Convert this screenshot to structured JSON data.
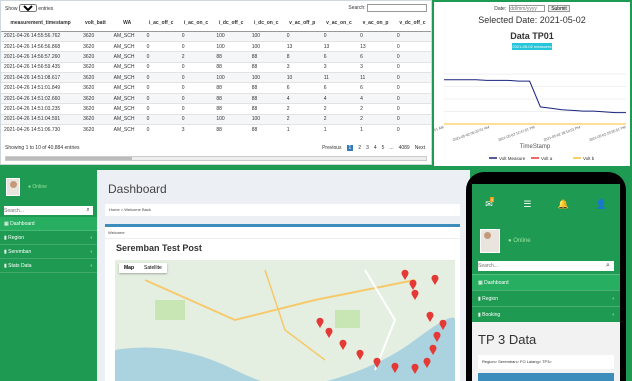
{
  "table": {
    "show_label": "Show",
    "show_value": "10",
    "entries_label": "entries",
    "search_label": "Search:",
    "headers": [
      "measurement_timestamp",
      "volt_batt",
      "WA",
      "i_ac_off_c",
      "i_ac_on_c",
      "i_dc_off_c",
      "i_dc_on_c",
      "v_ac_off_p",
      "v_ac_on_c",
      "v_ac_on_p",
      "v_dc_off_c"
    ],
    "rows": [
      [
        "2021-04-26 14:55:56.762",
        "3620",
        "AM_SCH",
        "0",
        "0",
        "100",
        "100",
        "0",
        "0",
        "0",
        "0"
      ],
      [
        "2021-04-26 14:56:56.868",
        "3620",
        "AM_SCH",
        "0",
        "0",
        "100",
        "100",
        "13",
        "13",
        "13",
        "0"
      ],
      [
        "2021-04-26 14:56:57.260",
        "3620",
        "AM_SCH",
        "0",
        "2",
        "88",
        "88",
        "8",
        "6",
        "6",
        "0"
      ],
      [
        "2021-04-26 14:56:59.435",
        "3620",
        "AM_SCH",
        "0",
        "0",
        "88",
        "88",
        "3",
        "3",
        "3",
        "0"
      ],
      [
        "2021-04-26 14:51:08.617",
        "3620",
        "AM_SCH",
        "0",
        "0",
        "100",
        "100",
        "10",
        "11",
        "11",
        "0"
      ],
      [
        "2021-04-26 14:51:01.849",
        "3620",
        "AM_SCH",
        "0",
        "0",
        "88",
        "88",
        "6",
        "6",
        "6",
        "0"
      ],
      [
        "2021-04-26 14:51:02.660",
        "3620",
        "AM_SCH",
        "0",
        "0",
        "88",
        "88",
        "4",
        "4",
        "4",
        "0"
      ],
      [
        "2021-04-26 14:51:03.235",
        "3620",
        "AM_SCH",
        "0",
        "0",
        "88",
        "88",
        "2",
        "2",
        "2",
        "0"
      ],
      [
        "2021-04-26 14:51:04.591",
        "3620",
        "AM_SCH",
        "0",
        "0",
        "100",
        "100",
        "2",
        "2",
        "2",
        "0"
      ],
      [
        "2021-04-26 14:51:06.730",
        "3620",
        "AM_SCH",
        "0",
        "3",
        "88",
        "88",
        "1",
        "1",
        "1",
        "0"
      ]
    ],
    "info": "Showing 1 to 10 of 40,884 entries",
    "pager": {
      "prev": "Previous",
      "pages": [
        "1",
        "2",
        "3",
        "4",
        "5",
        "...",
        "4089"
      ],
      "next": "Next"
    }
  },
  "chart_panel": {
    "date_label": "Date:",
    "date_placeholder": "dd/mm/yyyy",
    "submit_label": "Submit",
    "selected_date": "Selected Date: 2021-05-02",
    "title": "Data TP01",
    "badge": "2021-05-02 measures",
    "chart_data": {
      "type": "line",
      "xlabel": "TimeStamp",
      "x_ticks": [
        "2021-05-02 00:51:51 AM",
        "2021-05-02 06:22:51 AM",
        "2021-05-02 12:47:51 PM",
        "2021-05-02 18:10:51 PM",
        "2021-05-02 23:55:51 PM"
      ],
      "series": [
        {
          "name": "Volt Measure",
          "color": "#1a237e",
          "values": [
            62,
            62,
            62,
            62,
            61,
            61,
            61,
            60,
            60,
            24,
            22,
            20,
            19,
            18,
            18,
            17,
            16,
            16
          ]
        },
        {
          "name": "Volt a",
          "color": "#e53935",
          "values": [
            0,
            0,
            0,
            0,
            0,
            0,
            0,
            0,
            0,
            0,
            0,
            0,
            0,
            0,
            0,
            0,
            0,
            0
          ]
        },
        {
          "name": "Volt b",
          "color": "#fbc02d",
          "values": [
            0,
            0,
            0,
            0,
            0,
            0,
            0,
            0,
            0,
            0,
            0,
            0,
            0,
            0,
            0,
            0,
            0,
            0
          ]
        }
      ],
      "ylim": [
        0,
        70
      ],
      "legend": "bottom"
    }
  },
  "sidebar": {
    "status": "Online",
    "search_placeholder": "Search...",
    "items": [
      {
        "label": "Dashboard"
      },
      {
        "label": "Region"
      },
      {
        "label": "Seremban"
      },
      {
        "label": "Stats Data"
      }
    ]
  },
  "dashboard": {
    "title": "Dashboard",
    "breadcrumb": "Home > Welcome Back",
    "card_head": "Welcome",
    "card_title": "Seremban Test Post",
    "map_tabs": [
      "Map",
      "Satellite"
    ]
  },
  "phone": {
    "status": "Online",
    "search_placeholder": "Search...",
    "nav_badge": "4",
    "items": [
      {
        "label": "Dashboard"
      },
      {
        "label": "Region"
      },
      {
        "label": "Booking"
      }
    ],
    "title": "TP 3 Data",
    "breadcrumb": "Region> Seremban> FO Lalang> TP3>"
  },
  "colors": {
    "green": "#1f9a52",
    "blue": "#3c8dbc",
    "line": "#1a237e"
  }
}
